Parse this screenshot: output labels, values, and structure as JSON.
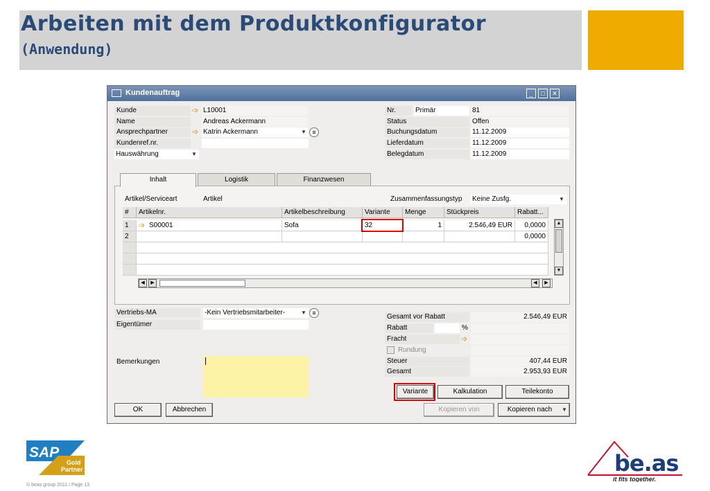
{
  "slide": {
    "title": "Arbeiten mit dem Produktkonfigurator",
    "subtitle": "(Anwendung)",
    "copyright": "© beas group 2011 / Page 13",
    "sap_logo": {
      "brand": "SAP",
      "line1": "Gold",
      "line2": "Partner"
    },
    "beas_logo": {
      "brand": "be.as",
      "tagline": "it fits together."
    },
    "colors": {
      "title": "#2a4a78",
      "accent": "#f0ab00",
      "highlight": "#d90000"
    }
  },
  "window": {
    "title": "Kundenauftrag",
    "buttons": {
      "minimize": "_",
      "maximize": "□",
      "close": "✕"
    }
  },
  "header_left": {
    "kunde_label": "Kunde",
    "kunde_value": "L10001",
    "name_label": "Name",
    "name_value": "Andreas Ackermann",
    "ansprech_label": "Ansprechpartner",
    "ansprech_value": "Katrin Ackermann",
    "kundenref_label": "Kundenref.nr.",
    "kundenref_value": "",
    "waehrung_value": "Hauswährung"
  },
  "header_right": {
    "nr_label": "Nr.",
    "nr_series": "Primär",
    "nr_value": "81",
    "status_label": "Status",
    "status_value": "Offen",
    "buchung_label": "Buchungsdatum",
    "buchung_value": "11.12.2009",
    "liefer_label": "Lieferdatum",
    "liefer_value": "11.12.2009",
    "beleg_label": "Belegdatum",
    "beleg_value": "11.12.2009"
  },
  "tabs": [
    {
      "label": "Inhalt"
    },
    {
      "label": "Logistik"
    },
    {
      "label": "Finanzwesen"
    }
  ],
  "content": {
    "serviceart_label": "Artikel/Serviceart",
    "serviceart_value": "Artikel",
    "zusfg_label": "Zusammenfassungstyp",
    "zusfg_value": "Keine Zusfg."
  },
  "grid": {
    "columns": [
      "#",
      "Artikelnr.",
      "Artikelbeschreibung",
      "Variante",
      "Menge",
      "Stückpreis",
      "Rabatt..."
    ],
    "rows": [
      {
        "num": "1",
        "artikel": "S00001",
        "beschreibung": "Sofa",
        "variante": "32",
        "menge": "1",
        "preis": "2.546,49 EUR",
        "rabatt": "0,0000"
      },
      {
        "num": "2",
        "artikel": "",
        "beschreibung": "",
        "variante": "",
        "menge": "",
        "preis": "",
        "rabatt": "0,0000"
      }
    ]
  },
  "footer_left": {
    "vertrieb_label": "Vertriebs-MA",
    "vertrieb_value": "-Kein Vertriebsmitarbeiter-",
    "eigentuemer_label": "Eigentümer",
    "eigentuemer_value": "",
    "bemerkungen_label": "Bemerkungen"
  },
  "totals": {
    "vor_rabatt_label": "Gesamt vor Rabatt",
    "vor_rabatt_value": "2.546,49 EUR",
    "rabatt_label": "Rabatt",
    "rabatt_pct": "%",
    "fracht_label": "Fracht",
    "rundung_label": "Rundung",
    "steuer_label": "Steuer",
    "steuer_value": "407,44 EUR",
    "gesamt_label": "Gesamt",
    "gesamt_value": "2.953,93 EUR"
  },
  "buttons": {
    "variante": "Variante",
    "kalkulation": "Kalkulation",
    "teilekonto": "Teilekonto",
    "ok": "OK",
    "abbrechen": "Abbrechen",
    "kopieren_von": "Kopieren von",
    "kopieren_nach": "Kopieren nach"
  }
}
